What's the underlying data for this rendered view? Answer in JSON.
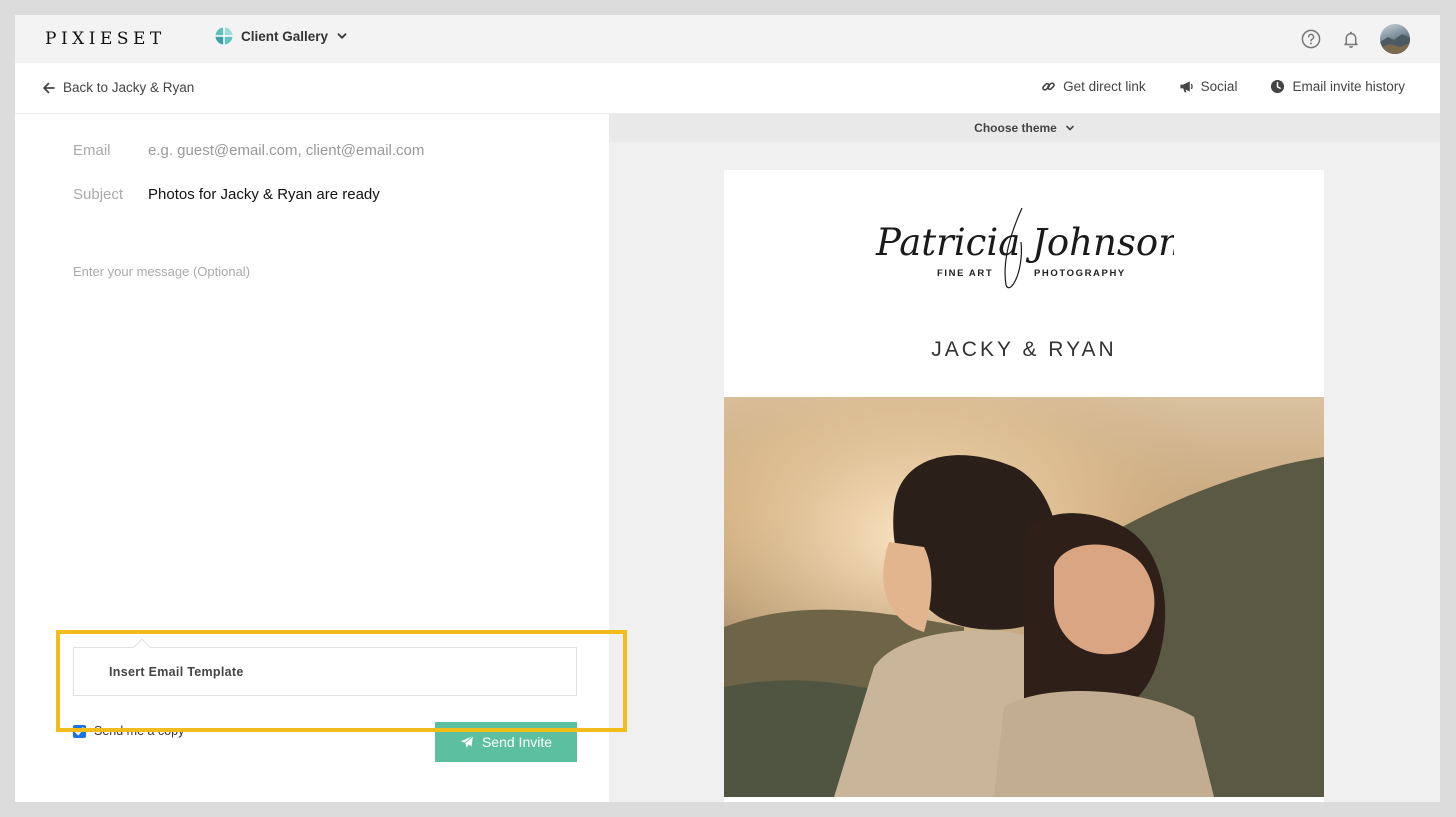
{
  "app": {
    "logo": "PIXIESET",
    "product": "Client Gallery"
  },
  "subnav": {
    "back_label": "Back to Jacky & Ryan",
    "actions": [
      "Get direct link",
      "Social",
      "Email invite history"
    ]
  },
  "compose": {
    "email_label": "Email",
    "email_placeholder": "e.g. guest@email.com, client@email.com",
    "subject_label": "Subject",
    "subject_value": "Photos for Jacky & Ryan are ready",
    "message_placeholder": "Enter your message (Optional)",
    "template_label": "Insert Email Template",
    "send_copy_label": "Send me a copy",
    "send_copy_checked": true,
    "send_label": "Send Invite"
  },
  "preview": {
    "theme_label": "Choose theme",
    "brand_script": "Patricia Johnson",
    "brand_left": "FINE ART",
    "brand_right": "PHOTOGRAPHY",
    "gallery_title": "JACKY & RYAN"
  },
  "colors": {
    "accent_green": "#5cc0a0",
    "highlight": "#f2bc1b",
    "topbar_bg": "#f4f3f4"
  },
  "icons": {
    "product": "client-gallery-icon",
    "help": "help-icon",
    "notifications": "bell-icon",
    "back": "arrow-left-icon",
    "link": "link-icon",
    "social": "megaphone-icon",
    "history": "clock-icon",
    "send": "paper-plane-icon"
  }
}
